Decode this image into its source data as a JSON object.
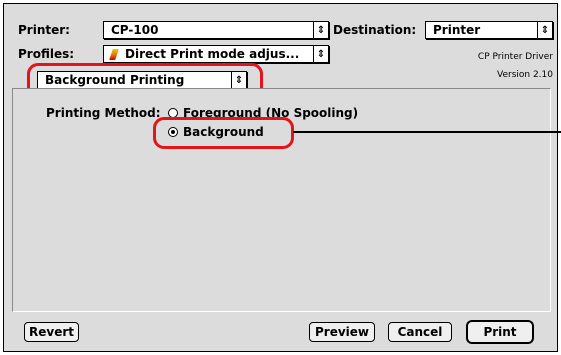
{
  "printer": {
    "label": "Printer:",
    "value": "CP-100"
  },
  "destination": {
    "label": "Destination:",
    "value": "Printer"
  },
  "profiles": {
    "label": "Profiles:",
    "value": "Direct Print mode adjus..."
  },
  "driver": {
    "name": "CP Printer Driver",
    "version": "Version 2.10"
  },
  "panel": {
    "value": "Background Printing"
  },
  "printing_method": {
    "label": "Printing Method:",
    "options": [
      "Foreground (No Spooling)",
      "Background"
    ],
    "selected": "Background"
  },
  "buttons": {
    "revert": "Revert",
    "preview": "Preview",
    "cancel": "Cancel",
    "print": "Print"
  },
  "colors": {
    "callout": "#e4141e",
    "dialog_bg": "#dcdcdc"
  }
}
